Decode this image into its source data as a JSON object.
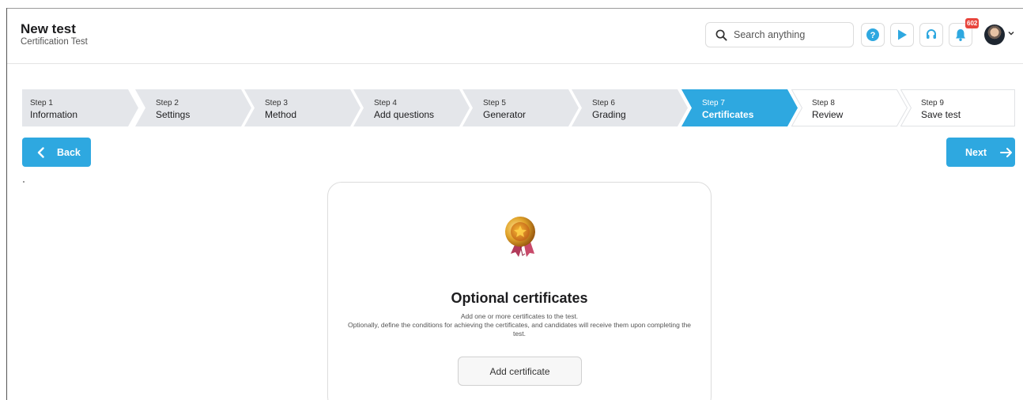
{
  "header": {
    "title": "New test",
    "subtitle": "Certification Test",
    "search_placeholder": "Search anything",
    "notification_count": "602"
  },
  "steps": [
    {
      "number": "Step 1",
      "label": "Information",
      "state": "done"
    },
    {
      "number": "Step 2",
      "label": "Settings",
      "state": "done"
    },
    {
      "number": "Step 3",
      "label": "Method",
      "state": "done"
    },
    {
      "number": "Step 4",
      "label": "Add questions",
      "state": "done"
    },
    {
      "number": "Step 5",
      "label": "Generator",
      "state": "done"
    },
    {
      "number": "Step 6",
      "label": "Grading",
      "state": "done"
    },
    {
      "number": "Step 7",
      "label": "Certificates",
      "state": "active"
    },
    {
      "number": "Step 8",
      "label": "Review",
      "state": "pending"
    },
    {
      "number": "Step 9",
      "label": "Save test",
      "state": "pending"
    }
  ],
  "nav": {
    "back_label": "Back",
    "next_label": "Next"
  },
  "card": {
    "title": "Optional certificates",
    "description_line1": "Add one or more certificates to the test.",
    "description_line2": "Optionally, define the conditions for achieving the certificates, and candidates will receive them upon completing the test.",
    "button_label": "Add certificate"
  },
  "icons": {
    "search": "search-icon",
    "help": "help-icon",
    "play": "play-icon",
    "support": "headset-icon",
    "notifications": "bell-icon",
    "certificate": "medal-icon"
  },
  "colors": {
    "accent": "#2ea8e0",
    "step_done": "#e4e6ea",
    "step_pending": "#ffffff",
    "badge": "#e8453c"
  }
}
